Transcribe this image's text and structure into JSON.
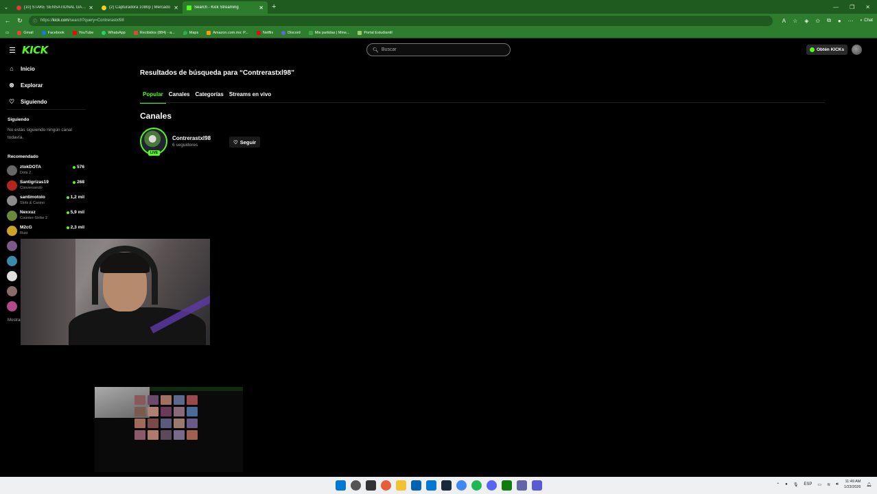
{
  "browser": {
    "tabs": [
      {
        "title": "[10] STAKE SENSATIONAL GANA!!",
        "favicon_color": "#e53935",
        "active": false
      },
      {
        "title": "(2) Capturadora 1080p | Mercado",
        "favicon_color": "#f5d020",
        "active": false
      },
      {
        "title": "Search - Kick Streaming",
        "favicon_color": "#53fc18",
        "active": true
      }
    ],
    "new_tab": "+",
    "url": {
      "prefix": "https://",
      "host": "kick.com",
      "path": "/search?query=Contrerastxl98"
    },
    "chat_label": "Chat",
    "bookmarks": [
      {
        "label": "Gmail",
        "color": "#ea4335"
      },
      {
        "label": "Facebook",
        "color": "#1877f2"
      },
      {
        "label": "YouTube",
        "color": "#ff0000"
      },
      {
        "label": "WhatsApp",
        "color": "#25d366"
      },
      {
        "label": "Recibidos (884) - a...",
        "color": "#ea4335"
      },
      {
        "label": "Maps",
        "color": "#34a853"
      },
      {
        "label": "Amazon.com.mx: P...",
        "color": "#ff9900"
      },
      {
        "label": "Netflix",
        "color": "#e50914"
      },
      {
        "label": "Discord",
        "color": "#5865f2"
      },
      {
        "label": "Mis partidas | Mine...",
        "color": "#43a047"
      },
      {
        "label": "Portal Estudiantil",
        "color": "#9ccc65"
      }
    ]
  },
  "header": {
    "logo": "KICK",
    "search_placeholder": "Buscar",
    "kicks_button": "Obtén KICKs"
  },
  "sidebar": {
    "nav": [
      {
        "label": "Inicio",
        "icon": "home-icon"
      },
      {
        "label": "Explorar",
        "icon": "compass-icon"
      },
      {
        "label": "Siguiendo",
        "icon": "heart-icon"
      }
    ],
    "following_heading": "Siguiendo",
    "following_empty": "No estás siguiendo ningún canal todavía.",
    "recommended_heading": "Recomendado",
    "recommended": [
      {
        "name": "ztokDOTA",
        "category": "Dota 2",
        "viewers": "576",
        "color": "#666"
      },
      {
        "name": "Santigrizas19",
        "category": "Conversando",
        "viewers": "268",
        "color": "#b3261e"
      },
      {
        "name": "santimotolo",
        "category": "Slots & Casino",
        "viewers": "1,2 mil",
        "color": "#8c8c8c"
      },
      {
        "name": "Nexxuz",
        "category": "Counter-Strike 2",
        "viewers": "5,9 mil",
        "color": "#6a8a3a"
      },
      {
        "name": "M2cG",
        "category": "Rust",
        "viewers": "2,3 mil",
        "color": "#c9a227"
      }
    ],
    "more_avatars": [
      "#7a5a8a",
      "#3a8aa8",
      "#dddddd",
      "#8a6a6a",
      "#b04a8a"
    ],
    "show_more": "Mostrar más"
  },
  "main": {
    "results_title": "Resultados de búsqueda para “Contrerastxl98”",
    "tabs": [
      "Popular",
      "Canales",
      "Categorías",
      "Streams en vivo"
    ],
    "active_tab": "Popular",
    "section_title": "Canales",
    "channel": {
      "name": "Contrerastxl98",
      "followers": "6 seguidores",
      "live_tag": "LIVE",
      "follow_label": "Seguir"
    }
  },
  "taskbar": {
    "icon_colors": [
      "#0078d4",
      "#555",
      "#333",
      "#e85d3a",
      "#f2c230",
      "#0063b1",
      "#0078d4",
      "#1b2838",
      "#4285f4",
      "#1db954",
      "#5865f2",
      "#107c10",
      "#6264a7",
      "#5a5ad6"
    ],
    "tray": {
      "language": "ESP"
    },
    "time": "11:49 AM",
    "date": "1/23/2026"
  }
}
